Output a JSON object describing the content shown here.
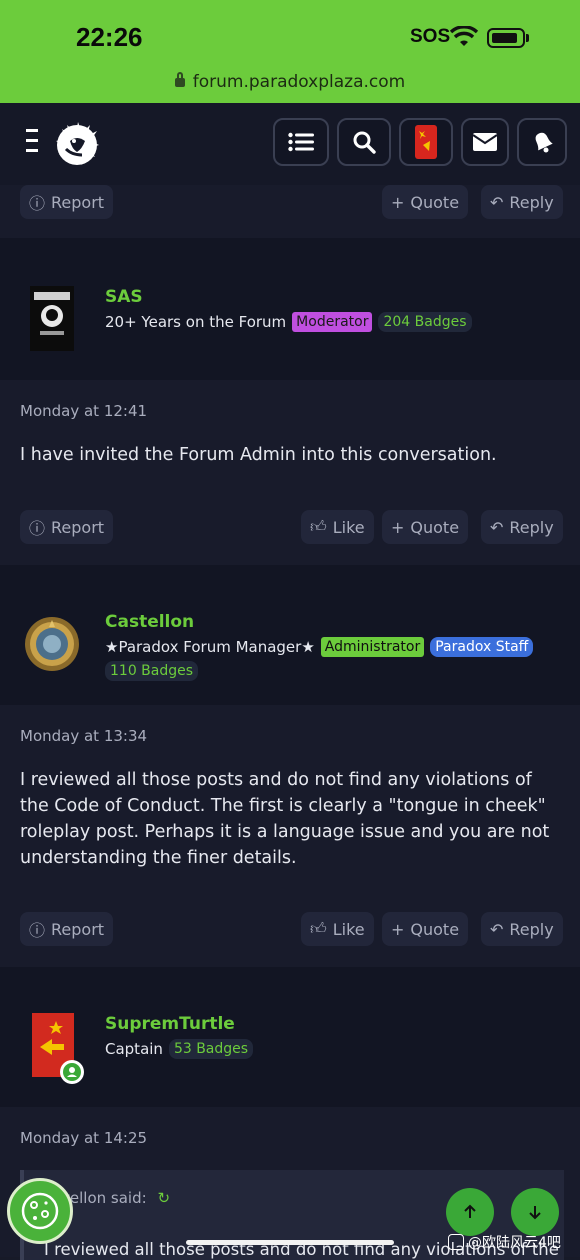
{
  "status_bar": {
    "time": "22:26",
    "sos": "SOS",
    "url": "forum.paradoxplaza.com"
  },
  "colors": {
    "accent": "#6ccc3c",
    "background": "#171a28",
    "moderator": "#c04fe0",
    "staff": "#3b6fdc"
  },
  "nav": {
    "icons": [
      "menu-icon",
      "search-icon",
      "user-avatar",
      "mail-icon",
      "bell-icon"
    ]
  },
  "actions": {
    "report": "Report",
    "like": "Like",
    "quote": "Quote",
    "reply": "Reply"
  },
  "posts": [
    {
      "username": "SAS",
      "title": "20+ Years on the Forum",
      "tags": [
        "Moderator"
      ],
      "badges": "204 Badges",
      "date": "Monday at 12:41",
      "body": "I have invited the Forum Admin into this conversation."
    },
    {
      "username": "Castellon",
      "title": "★Paradox Forum Manager★",
      "tags": [
        "Administrator",
        "Paradox Staff"
      ],
      "badges": "110 Badges",
      "date": "Monday at 13:34",
      "body": "I reviewed all those posts and do not find any violations of the Code of Conduct. The first is clearly a \"tongue in cheek\" roleplay post. Perhaps it is a language issue and you are not understanding the finer details."
    },
    {
      "username": "SupremTurtle",
      "title": "Captain",
      "badges": "53 Badges",
      "date": "Monday at 14:25",
      "quote_author": "tellon said:",
      "quote_text": "I reviewed all those posts and do not find any violations of the"
    }
  ],
  "watermark": "@欧陆风云4吧"
}
